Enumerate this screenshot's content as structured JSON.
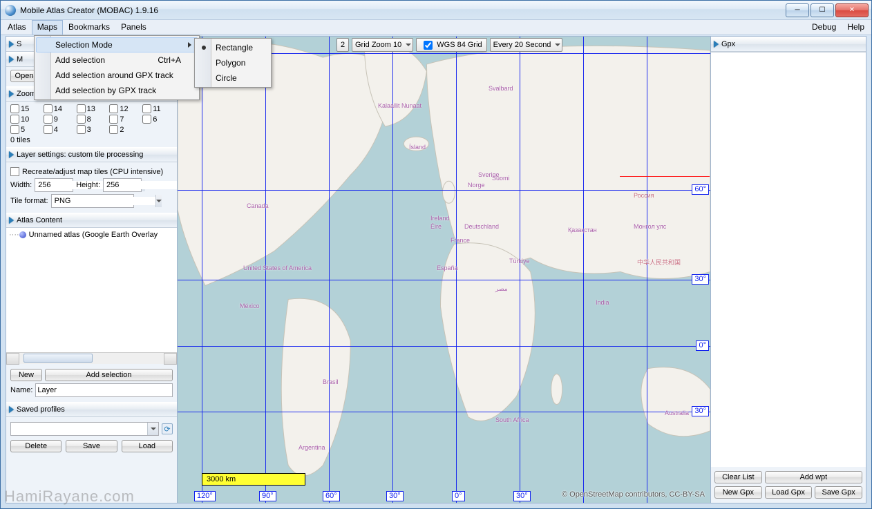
{
  "window": {
    "title": "Mobile Atlas Creator (MOBAC) 1.9.16",
    "buttons": {
      "min": "─",
      "max": "☐",
      "close": "✕"
    }
  },
  "menubar": {
    "left": [
      "Atlas",
      "Maps",
      "Bookmarks",
      "Panels"
    ],
    "right": [
      "Debug",
      "Help"
    ],
    "open_index": 1
  },
  "maps_menu": {
    "items": [
      {
        "label": "Selection Mode",
        "submenu": true
      },
      {
        "label": "Add selection",
        "shortcut": "Ctrl+A"
      },
      {
        "label": "Add selection around GPX track"
      },
      {
        "label": "Add selection by GPX track"
      }
    ],
    "submenu": {
      "selected_index": 0,
      "items": [
        "Rectangle",
        "Polygon",
        "Circle"
      ]
    }
  },
  "left": {
    "section0_peek": "S",
    "section1_peek": "M",
    "section1_button": "Open",
    "zoom": {
      "title": "Zoom Levels",
      "levels": [
        [
          "15",
          "14",
          "13",
          "12",
          "11"
        ],
        [
          "10",
          "9",
          "8",
          "7",
          "6"
        ],
        [
          "5",
          "4",
          "3",
          "2",
          ""
        ]
      ],
      "tiles": "0 tiles"
    },
    "layer": {
      "title": "Layer settings: custom tile processing",
      "recreate": "Recreate/adjust map tiles (CPU intensive)",
      "width_lbl": "Width:",
      "width_val": "256",
      "height_lbl": "Height:",
      "height_val": "256",
      "format_lbl": "Tile format:",
      "format_val": "PNG"
    },
    "atlas": {
      "title": "Atlas Content",
      "node": "Unnamed atlas (Google Earth Overlay",
      "new_btn": "New",
      "add_btn": "Add selection",
      "name_lbl": "Name:",
      "name_val": "Layer"
    },
    "profiles": {
      "title": "Saved profiles",
      "value": "",
      "delete": "Delete",
      "save": "Save",
      "load": "Load"
    }
  },
  "right": {
    "title": "Gpx",
    "clear": "Clear List",
    "addwpt": "Add wpt",
    "newgpx": "New Gpx",
    "loadgpx": "Load Gpx",
    "savegpx": "Save Gpx"
  },
  "toolbar": {
    "zoom_num": "2",
    "grid_zoom": "Grid Zoom 10",
    "wgs_check": true,
    "wgs_label": "WGS 84 Grid",
    "interval": "Every 20 Second"
  },
  "map": {
    "scalebar": "3000 km",
    "attribution": "© OpenStreetMap contributors, CC-BY-SA",
    "lat_labels": [
      "60°",
      "30°",
      "0°",
      "30°"
    ],
    "lon_labels": [
      "120°",
      "90°",
      "60°",
      "30°",
      "0°",
      "30°"
    ],
    "places": [
      "Canada",
      "United States of America",
      "Brasil",
      "Россия",
      "India",
      "España",
      "Australia",
      "Kalaallit Nunaat",
      "Svalbard",
      "中华人民共和国",
      "Монгол улс",
      "Қазақстан",
      "Türkiye",
      "مصر",
      "Argentina",
      "México",
      "South Africa",
      "France",
      "Deutschland",
      "Norge",
      "Suomi",
      "Sverige",
      "Ísland",
      "Ireland",
      "Éire"
    ]
  },
  "watermark": "HamiRayane.com"
}
